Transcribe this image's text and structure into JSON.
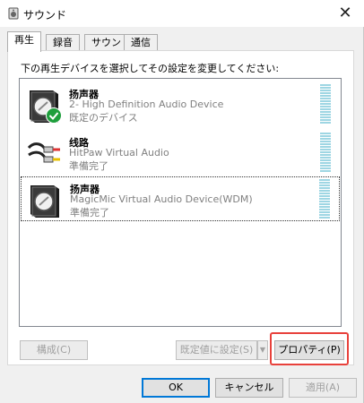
{
  "window": {
    "title": "サウンド",
    "close_glyph": "✕"
  },
  "tabs": [
    {
      "label": "再生",
      "active": true
    },
    {
      "label": "録音",
      "active": false
    },
    {
      "label": "サウンド",
      "active": false
    },
    {
      "label": "通信",
      "active": false
    }
  ],
  "instruction": "下の再生デバイスを選択してその設定を変更してください:",
  "devices": [
    {
      "name": "扬声器",
      "description": "2- High Definition Audio Device",
      "status": "既定のデバイス",
      "icon": "speaker-icon",
      "default_check": true,
      "selected": false
    },
    {
      "name": "线路",
      "description": "HitPaw Virtual Audio",
      "status": "準備完了",
      "icon": "audio-cable-icon",
      "default_check": false,
      "selected": false
    },
    {
      "name": "扬声器",
      "description": "MagicMic Virtual Audio Device(WDM)",
      "status": "準備完了",
      "icon": "speaker-icon",
      "default_check": false,
      "selected": true
    }
  ],
  "buttons": {
    "configure": "構成(C)",
    "set_default": "既定値に設定(S)",
    "properties": "プロパティ(P)",
    "ok": "OK",
    "cancel": "キャンセル",
    "apply": "適用(A)"
  },
  "colors": {
    "highlight": "#e8413b",
    "meter": "#9ed6e3",
    "check": "#1e9e3c"
  }
}
